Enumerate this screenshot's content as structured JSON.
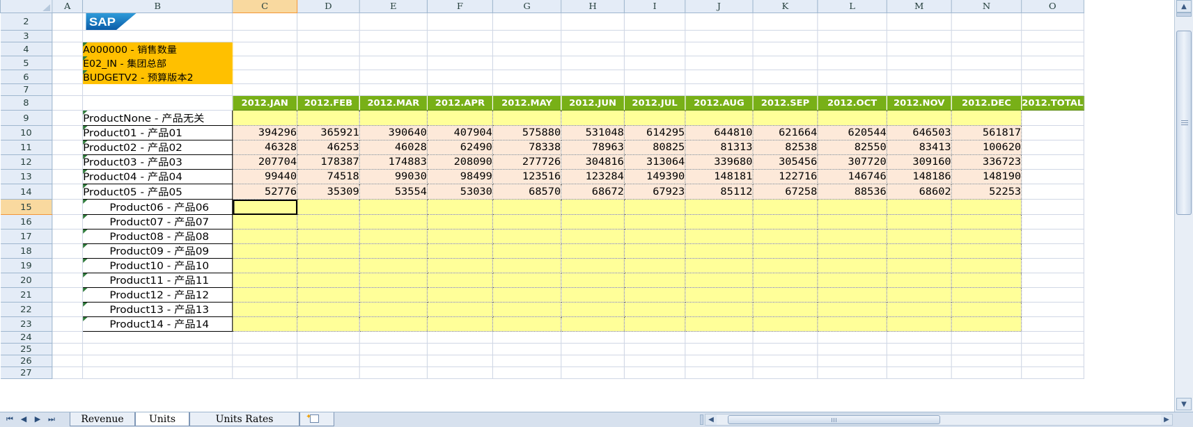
{
  "columns": [
    "A",
    "B",
    "C",
    "D",
    "E",
    "F",
    "G",
    "H",
    "I",
    "J",
    "K",
    "L",
    "M",
    "N",
    "O"
  ],
  "active_column": "C",
  "active_row": "15",
  "rows": [
    "2",
    "3",
    "4",
    "5",
    "6",
    "7",
    "8",
    "9",
    "10",
    "11",
    "12",
    "13",
    "14",
    "15",
    "16",
    "17",
    "18",
    "19",
    "20",
    "21",
    "22",
    "23",
    "24",
    "25",
    "26",
    "27"
  ],
  "logo": {
    "name": "SAP",
    "text": "SAP"
  },
  "info": [
    "A000000 - 销售数量",
    "E02_IN - 集团总部",
    "BUDGETV2 - 预算版本2"
  ],
  "months": [
    "2012.JAN",
    "2012.FEB",
    "2012.MAR",
    "2012.APR",
    "2012.MAY",
    "2012.JUN",
    "2012.JUL",
    "2012.AUG",
    "2012.SEP",
    "2012.OCT",
    "2012.NOV",
    "2012.DEC",
    "2012.TOTAL"
  ],
  "products": [
    {
      "label": "ProductNone - 产品无关",
      "values": [
        "",
        "",
        "",
        "",
        "",
        "",
        "",
        "",
        "",
        "",
        "",
        ""
      ]
    },
    {
      "label": "Product01 - 产品01",
      "values": [
        "394296",
        "365921",
        "390640",
        "407904",
        "575880",
        "531048",
        "614295",
        "644810",
        "621664",
        "620544",
        "646503",
        "561817"
      ]
    },
    {
      "label": "Product02 - 产品02",
      "values": [
        "46328",
        "46253",
        "46028",
        "62490",
        "78338",
        "78963",
        "80825",
        "81313",
        "82538",
        "82550",
        "83413",
        "100620"
      ]
    },
    {
      "label": "Product03 - 产品03",
      "values": [
        "207704",
        "178387",
        "174883",
        "208090",
        "277726",
        "304816",
        "313064",
        "339680",
        "305456",
        "307720",
        "309160",
        "336723"
      ]
    },
    {
      "label": "Product04 - 产品04",
      "values": [
        "99440",
        "74518",
        "99030",
        "98499",
        "123516",
        "123284",
        "149390",
        "148181",
        "122716",
        "146746",
        "148186",
        "148190"
      ]
    },
    {
      "label": "Product05 - 产品05",
      "values": [
        "52776",
        "35309",
        "53554",
        "53030",
        "68570",
        "68672",
        "67923",
        "85112",
        "67258",
        "88536",
        "68602",
        "52253"
      ]
    },
    {
      "label": "Product06 - 产品06",
      "values": []
    },
    {
      "label": "Product07 - 产品07",
      "values": []
    },
    {
      "label": "Product08 - 产品08",
      "values": []
    },
    {
      "label": "Product09 - 产品09",
      "values": []
    },
    {
      "label": "Product10 - 产品10",
      "values": []
    },
    {
      "label": "Product11 - 产品11",
      "values": []
    },
    {
      "label": "Product12 - 产品12",
      "values": []
    },
    {
      "label": "Product13 - 产品13",
      "values": []
    },
    {
      "label": "Product14 - 产品14",
      "values": []
    }
  ],
  "sheet_tabs": [
    "Revenue",
    "Units",
    "Units Rates"
  ],
  "active_sheet": "Units",
  "colors": {
    "accent_green": "#78b017",
    "info_orange": "#ffc000",
    "input_yellow": "#ffff99",
    "data_peach": "#fde9d9"
  }
}
